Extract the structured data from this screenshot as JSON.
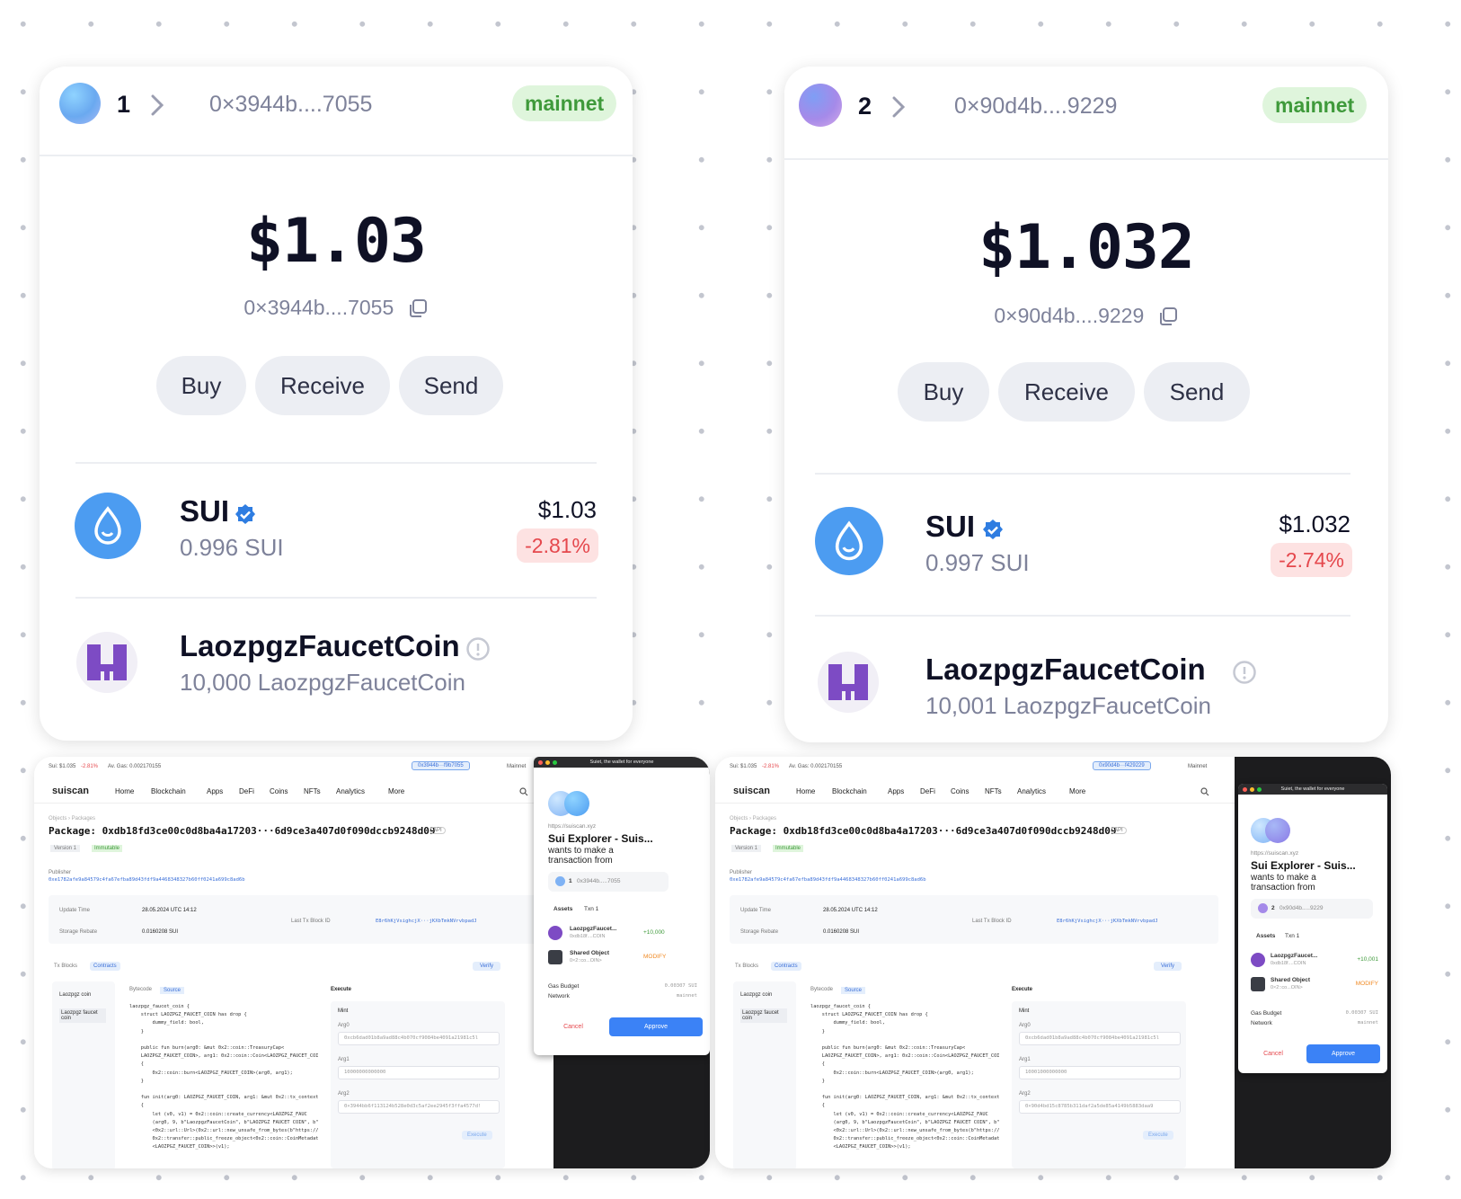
{
  "wallets": [
    {
      "index": "1",
      "header_address": "0×3944b....7055",
      "network": "mainnet",
      "balance": "$1.03",
      "address": "0×3944b....7055",
      "actions": {
        "buy": "Buy",
        "receive": "Receive",
        "send": "Send"
      },
      "coins": [
        {
          "name": "SUI",
          "amount": "0.996 SUI",
          "usd": "$1.03",
          "change": "-2.81%"
        },
        {
          "name": "LaozpgzFaucetCoin",
          "amount": "10,000 LaozpgzFaucetCoin"
        }
      ]
    },
    {
      "index": "2",
      "header_address": "0×90d4b....9229",
      "network": "mainnet",
      "balance": "$1.032",
      "address": "0×90d4b....9229",
      "actions": {
        "buy": "Buy",
        "receive": "Receive",
        "send": "Send"
      },
      "coins": [
        {
          "name": "SUI",
          "amount": "0.997 SUI",
          "usd": "$1.032",
          "change": "-2.74%"
        },
        {
          "name": "LaozpgzFaucetCoin",
          "amount": "10,001 LaozpgzFaucetCoin"
        }
      ]
    }
  ],
  "screenshots": [
    {
      "top_sui": "Sui: $1.035",
      "top_change": "-2.81%",
      "top_gas": "Av. Gas: 0.002170155",
      "connected": "0x3944b···f9b7055",
      "network": "Mainnet",
      "nav": {
        "logo": "suiscan",
        "home": "Home",
        "blockchain": "Blockchain",
        "apps": "Apps",
        "defi": "DeFi",
        "coins": "Coins",
        "nfts": "NFTs",
        "analytics": "Analytics",
        "more": "More"
      },
      "crumb": "Objects › Packages",
      "package": "Package: 0xdb18fd3ce00c0d8ba4a17203···6d9ce3a407d0f090dccb9248d09",
      "api": "API",
      "version": "Version 1",
      "immutable": "Immutable",
      "publisher_label": "Publisher",
      "publisher": "0xe1782afe9a84579c4fa67efba89d43fdf9a4468348327b60ff0241a699c8ad6b",
      "update_label": "Update Time",
      "update_time": "28.05.2024 UTC 14:12",
      "rebate_label": "Storage Rebate",
      "rebate": "0.0160208 SUI",
      "lasttx_label": "Last Tx Block ID",
      "lasttx": "E8r6hKjVsighcjX···jKXbTmkNVrvbpadJ",
      "tab_txblocks": "Tx Blocks",
      "tab_contracts": "Contracts",
      "verify": "Verify",
      "mod1": "Laozpgz coin",
      "mod2": "Laozpgz faucet coin",
      "bytecode": "Bytecode",
      "source": "Source",
      "code": "laozpgz_faucet_coin {\n    struct LAOZPGZ_FAUCET_COIN has drop {\n        dummy_field: bool,\n    }\n\n    public fun burn(arg0: &mut 0x2::coin::TreasuryCap<\n    LAOZPGZ_FAUCET_COIN>, arg1: 0x2::coin::Coin<LAOZPGZ_FAUCET_COIN>)\n    {\n        0x2::coin::burn<LAOZPGZ_FAUCET_COIN>(arg0, arg1);\n    }\n\n    fun init(arg0: LAOZPGZ_FAUCET_COIN, arg1: &mut 0x2::tx_context::\n    {\n        let (v0, v1) = 0x2::coin::create_currency<LAOZPGZ_FAUC\n        (arg0, 9, b\"LaozpgzFaucetCoin\", b\"LAOZPGZ FAUCET COIN\", b\"lets_move\n        <0x2::url::Url>(0x2::url::new_unsafe_from_bytes(b\"https://avatars.g\n        0x2::transfer::public_freeze_object<0x2::coin::CoinMetadata\n        <LAOZPGZ_FAUCET_COIN>>(v1);",
      "execute": "Execute",
      "mint": "Mint",
      "arg0_label": "Arg0",
      "arg0": "0xcb6dad01b8a9ad88c4b070cf9084be4091a21981c5l",
      "arg1_label": "Arg1",
      "arg1": "10000000000000",
      "arg2_label": "Arg2",
      "arg2": "0×3944bb6f113124b528e0d3c5af2ee2945f3ffa4577d!",
      "execute_btn": "Execute",
      "popup": {
        "bar": "Suiet, the wallet for everyone",
        "url": "https://suiscan.xyz",
        "title": "Sui Explorer - Suis...",
        "subtitle": "wants to make a transaction from",
        "account_index": "1",
        "account_addr": "0x3944b.....7055",
        "tab_assets": "Assets",
        "tab_txn": "Txn 1",
        "asset_name": "LaozpgzFaucet...",
        "asset_sub": "0xdb18f....COIN",
        "asset_delta": "+10,000",
        "shared_name": "Shared Object",
        "shared_sub": "0×2::co...OIN>",
        "shared_action": "MODIFY",
        "gas_label": "Gas Budget",
        "gas_value": "0.00307 SUI",
        "net_label": "Network",
        "net_value": "mainnet",
        "cancel": "Cancel",
        "approve": "Approve"
      }
    },
    {
      "top_sui": "Sui: $1.035",
      "top_change": "-2.81%",
      "top_gas": "Av. Gas: 0.002170155",
      "connected": "0x90d4b···f429229",
      "network": "Mainnet",
      "nav": {
        "logo": "suiscan",
        "home": "Home",
        "blockchain": "Blockchain",
        "apps": "Apps",
        "defi": "DeFi",
        "coins": "Coins",
        "nfts": "NFTs",
        "analytics": "Analytics",
        "more": "More"
      },
      "crumb": "Objects › Packages",
      "package": "Package: 0xdb18fd3ce00c0d8ba4a17203···6d9ce3a407d0f090dccb9248d09",
      "api": "API",
      "version": "Version 1",
      "immutable": "Immutable",
      "publisher_label": "Publisher",
      "publisher": "0xe1782afe9a84579c4fa67efba89d43fdf9a4468348327b60ff0241a699c8ad6b",
      "update_label": "Update Time",
      "update_time": "28.05.2024 UTC 14:12",
      "rebate_label": "Storage Rebate",
      "rebate": "0.0160208 SUI",
      "lasttx_label": "Last Tx Block ID",
      "lasttx": "E8r6hKjVsighcjX···jKXbTmkNVrvbpadJ",
      "tab_txblocks": "Tx Blocks",
      "tab_contracts": "Contracts",
      "verify": "Verify",
      "mod1": "Laozpgz coin",
      "mod2": "Laozpgz faucet coin",
      "bytecode": "Bytecode",
      "source": "Source",
      "code": "laozpgz_faucet_coin {\n    struct LAOZPGZ_FAUCET_COIN has drop {\n        dummy_field: bool,\n    }\n\n    public fun burn(arg0: &mut 0x2::coin::TreasuryCap<\n    LAOZPGZ_FAUCET_COIN>, arg1: 0x2::coin::Coin<LAOZPGZ_FAUCET_COIN>)\n    {\n        0x2::coin::burn<LAOZPGZ_FAUCET_COIN>(arg0, arg1);\n    }\n\n    fun init(arg0: LAOZPGZ_FAUCET_COIN, arg1: &mut 0x2::tx_context::\n    {\n        let (v0, v1) = 0x2::coin::create_currency<LAOZPGZ_FAUC\n        (arg0, 9, b\"LaozpgzFaucetCoin\", b\"LAOZPGZ FAUCET COIN\", b\"lets_move\n        <0x2::url::Url>(0x2::url::new_unsafe_from_bytes(b\"https://avatars.g\n        0x2::transfer::public_freeze_object<0x2::coin::CoinMetadata\n        <LAOZPGZ_FAUCET_COIN>>(v1);",
      "execute": "Execute",
      "mint": "Mint",
      "arg0_label": "Arg0",
      "arg0": "0xcb6dad01b8a9ad88c4b070cf9084be4091a21981c5l",
      "arg1_label": "Arg1",
      "arg1": "10001000000000",
      "arg2_label": "Arg2",
      "arg2": "0×90d4bd15c8785b311daf2a5de85a4149b5883daa9",
      "execute_btn": "Execute",
      "popup": {
        "bar": "Suiet, the wallet for everyone",
        "url": "https://suiscan.xyz",
        "title": "Sui Explorer - Suis...",
        "subtitle": "wants to make a transaction from",
        "account_index": "2",
        "account_addr": "0x90d4b.....9229",
        "tab_assets": "Assets",
        "tab_txn": "Txn 1",
        "asset_name": "LaozpgzFaucet...",
        "asset_sub": "0xdb18f....COIN",
        "asset_delta": "+10,001",
        "shared_name": "Shared Object",
        "shared_sub": "0×2::co...OIN>",
        "shared_action": "MODIFY",
        "gas_label": "Gas Budget",
        "gas_value": "0.00307 SUI",
        "net_label": "Network",
        "net_value": "mainnet",
        "cancel": "Cancel",
        "approve": "Approve"
      }
    }
  ],
  "colors": {
    "accent": "#4c9cf1",
    "positive": "#3f9a3b",
    "negative": "#e5484d",
    "approve": "#3b82f6"
  },
  "icons": [
    "chevron-right-icon",
    "copy-icon",
    "sui-drop-icon",
    "verified-icon",
    "info-icon",
    "faucet-logo-icon",
    "search-icon"
  ]
}
